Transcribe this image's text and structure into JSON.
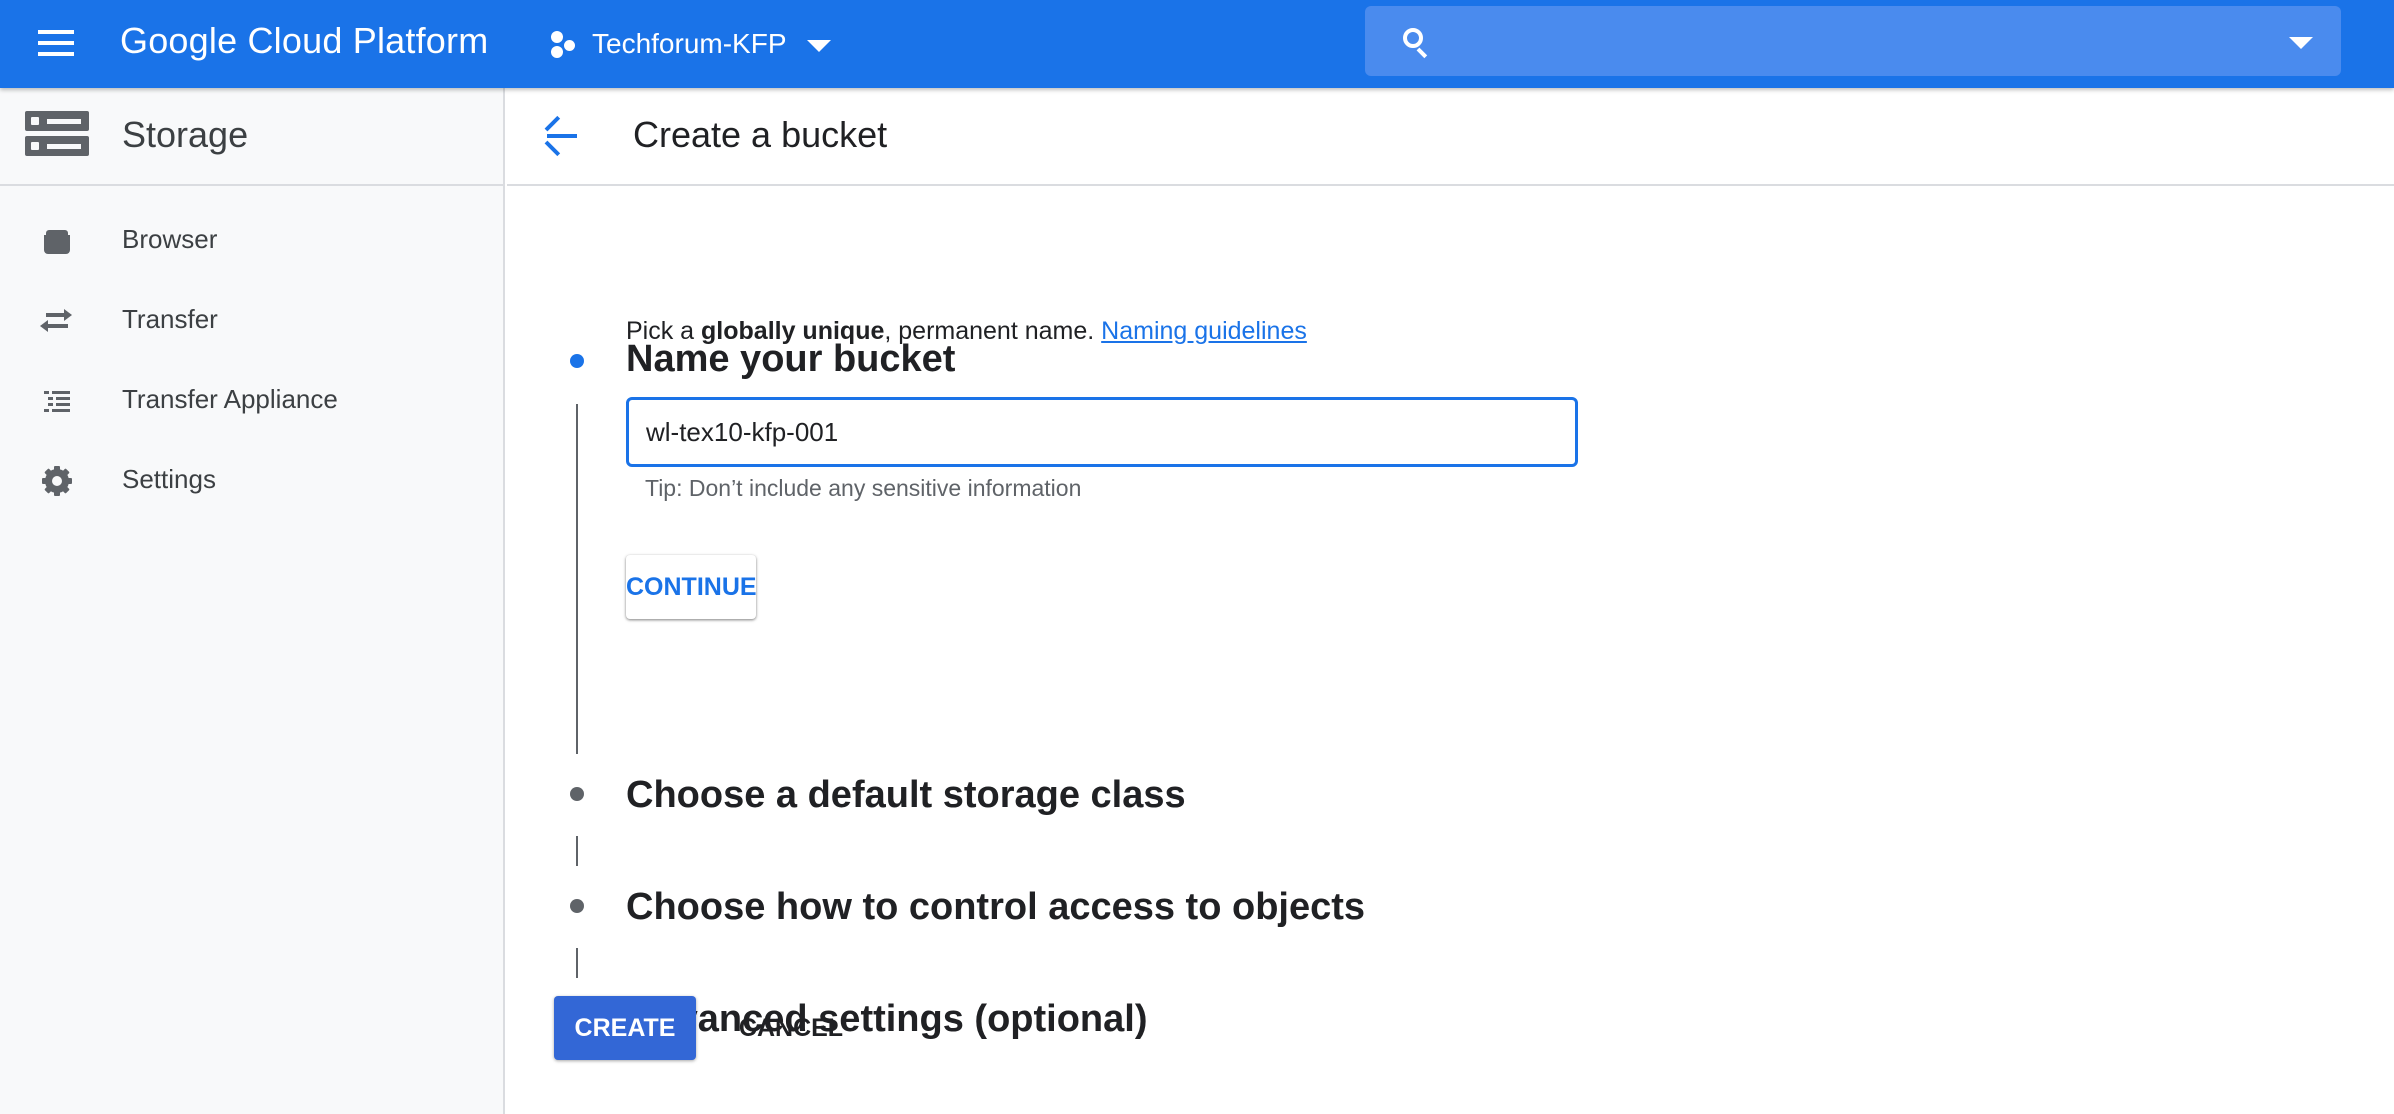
{
  "topbar": {
    "menu_icon": "hamburger-menu-icon",
    "brand": "Google Cloud Platform",
    "project_icon": "project-hexagon-icon",
    "project_name": "Techforum-KFP",
    "project_caret_icon": "caret-down-icon",
    "search_icon": "search-icon",
    "search_value": "",
    "search_caret_icon": "caret-down-icon",
    "bar_color": "#1a73e8"
  },
  "sidebar": {
    "title": "Storage",
    "title_icon": "storage-icon",
    "items": [
      {
        "label": "Browser",
        "icon": "shopping-bag-icon"
      },
      {
        "label": "Transfer",
        "icon": "swap-arrows-icon"
      },
      {
        "label": "Transfer Appliance",
        "icon": "list-icon"
      },
      {
        "label": "Settings",
        "icon": "gear-icon"
      }
    ]
  },
  "main": {
    "back_icon": "arrow-back-icon",
    "title": "Create a bucket",
    "steps": [
      {
        "title": "Name your bucket",
        "state": "active"
      },
      {
        "title": "Choose a default storage class",
        "state": "inactive"
      },
      {
        "title": "Choose how to control access to objects",
        "state": "inactive"
      },
      {
        "title": "Advanced settings (optional)",
        "state": "inactive"
      }
    ],
    "name_step": {
      "desc_prefix": "Pick a ",
      "desc_bold": "globally unique",
      "desc_suffix": ", permanent name. ",
      "desc_link": "Naming guidelines",
      "input_value": "wl-tex10-kfp-001",
      "tip": "Tip: Don’t include any sensitive information",
      "continue_label": "CONTINUE"
    },
    "create_label": "CREATE",
    "cancel_label": "CANCEL",
    "accent_color": "#1a73e8",
    "primary_button_color": "#3367d6"
  }
}
